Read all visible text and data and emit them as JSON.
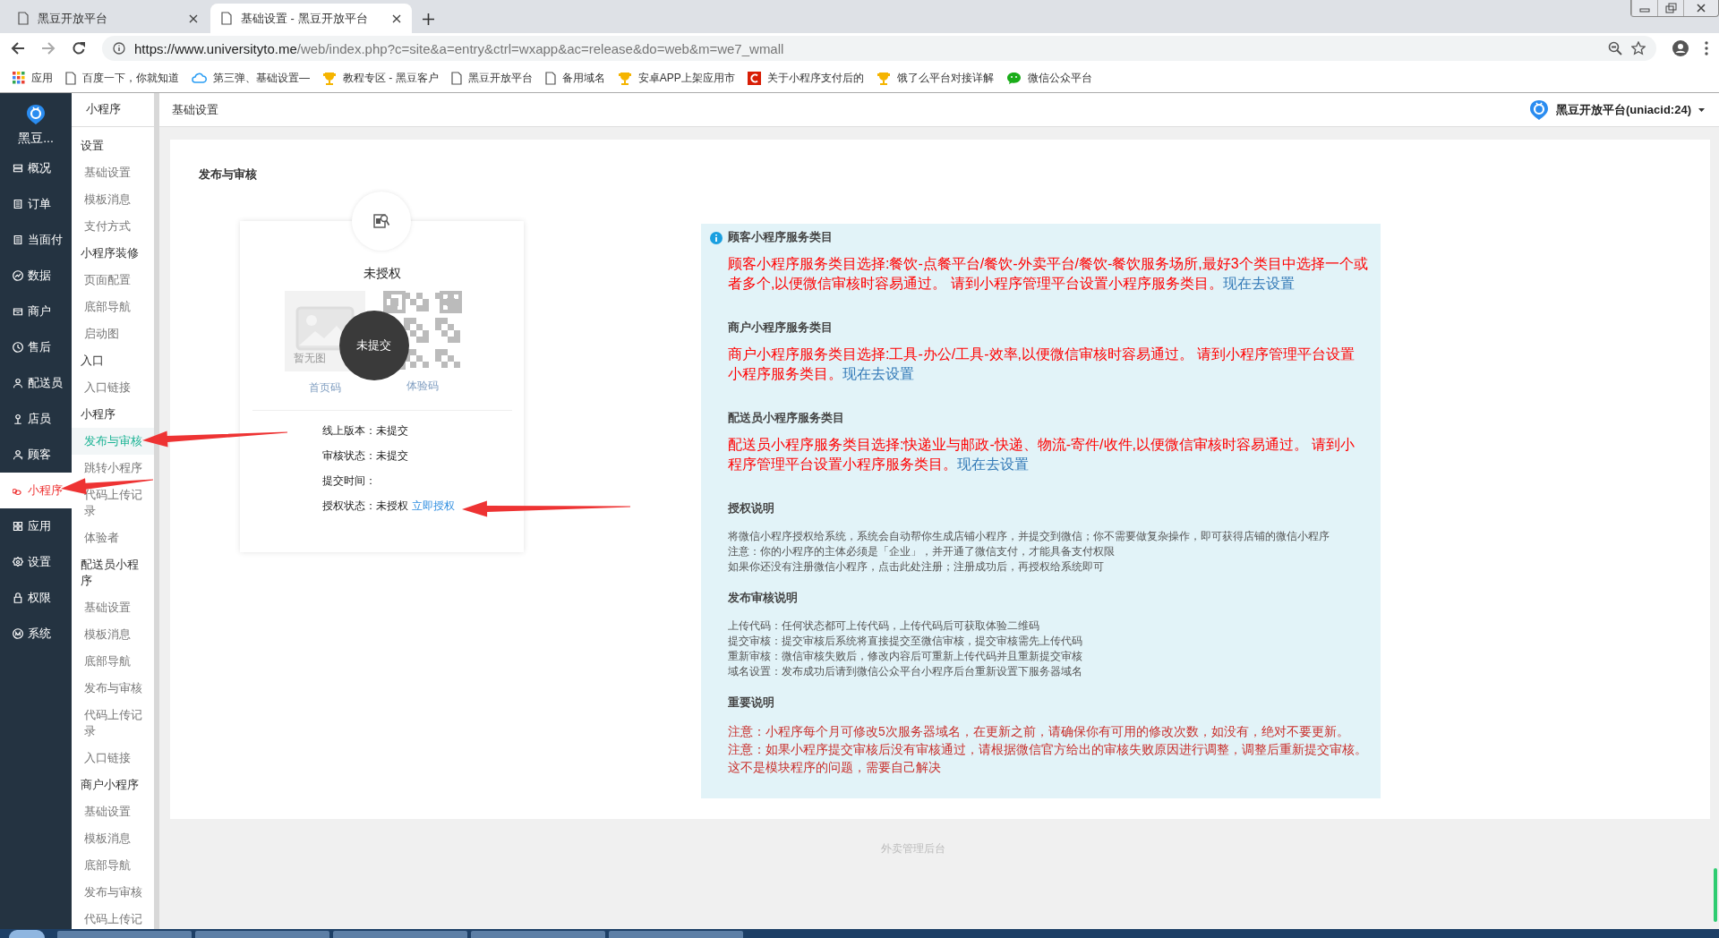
{
  "browser": {
    "tabs": [
      {
        "title": "黑豆开放平台",
        "selected": false
      },
      {
        "title": "基础设置 - 黑豆开放平台",
        "selected": true
      }
    ],
    "url": {
      "host": "https://www.universityto.me",
      "path": "/web/index.php?c=site&a=entry&ctrl=wxapp&ac=release&do=web&m=we7_wmall"
    },
    "bookmarks": [
      {
        "kind": "apps",
        "label": "应用"
      },
      {
        "kind": "page",
        "label": "百度一下，你就知道"
      },
      {
        "kind": "cloud",
        "label": "第三弹、基础设置—"
      },
      {
        "kind": "trophy",
        "label": "教程专区 - 黑豆客户"
      },
      {
        "kind": "page",
        "label": "黑豆开放平台"
      },
      {
        "kind": "page",
        "label": "备用域名"
      },
      {
        "kind": "trophy",
        "label": "安卓APP上架应用市"
      },
      {
        "kind": "red",
        "label": "关于小程序支付后的"
      },
      {
        "kind": "trophy",
        "label": "饿了么平台对接详解"
      },
      {
        "kind": "chat",
        "label": "微信公众平台"
      }
    ]
  },
  "app": {
    "brand": "黑豆...",
    "nav": [
      {
        "label": "概况",
        "selected": false
      },
      {
        "label": "订单",
        "selected": false
      },
      {
        "label": "当面付",
        "selected": false
      },
      {
        "label": "数据",
        "selected": false
      },
      {
        "label": "商户",
        "selected": false
      },
      {
        "label": "售后",
        "selected": false
      },
      {
        "label": "配送员",
        "selected": false
      },
      {
        "label": "店员",
        "selected": false
      },
      {
        "label": "顾客",
        "selected": false
      },
      {
        "label": "小程序",
        "selected": true
      },
      {
        "label": "应用",
        "selected": false
      },
      {
        "label": "设置",
        "selected": false
      },
      {
        "label": "权限",
        "selected": false
      },
      {
        "label": "系统",
        "selected": false
      }
    ],
    "subnav_title": "小程序",
    "subnav": [
      {
        "kind": "group",
        "label": "设置"
      },
      {
        "kind": "item",
        "label": "基础设置",
        "selected": false
      },
      {
        "kind": "item",
        "label": "模板消息",
        "selected": false
      },
      {
        "kind": "item",
        "label": "支付方式",
        "selected": false
      },
      {
        "kind": "group",
        "label": "小程序装修"
      },
      {
        "kind": "item",
        "label": "页面配置",
        "selected": false
      },
      {
        "kind": "item",
        "label": "底部导航",
        "selected": false
      },
      {
        "kind": "item",
        "label": "启动图",
        "selected": false
      },
      {
        "kind": "group",
        "label": "入口"
      },
      {
        "kind": "item",
        "label": "入口链接",
        "selected": false
      },
      {
        "kind": "group",
        "label": "小程序"
      },
      {
        "kind": "item",
        "label": "发布与审核",
        "selected": true
      },
      {
        "kind": "item",
        "label": "跳转小程序",
        "selected": false
      },
      {
        "kind": "item",
        "label": "代码上传记录",
        "selected": false
      },
      {
        "kind": "item",
        "label": "体验者",
        "selected": false
      },
      {
        "kind": "group",
        "label": "配送员小程序"
      },
      {
        "kind": "item",
        "label": "基础设置",
        "selected": false
      },
      {
        "kind": "item",
        "label": "模板消息",
        "selected": false
      },
      {
        "kind": "item",
        "label": "底部导航",
        "selected": false
      },
      {
        "kind": "item",
        "label": "发布与审核",
        "selected": false
      },
      {
        "kind": "item",
        "label": "代码上传记录",
        "selected": false
      },
      {
        "kind": "item",
        "label": "入口链接",
        "selected": false
      },
      {
        "kind": "group",
        "label": "商户小程序"
      },
      {
        "kind": "item",
        "label": "基础设置",
        "selected": false
      },
      {
        "kind": "item",
        "label": "模板消息",
        "selected": false
      },
      {
        "kind": "item",
        "label": "底部导航",
        "selected": false
      },
      {
        "kind": "item",
        "label": "发布与审核",
        "selected": false
      },
      {
        "kind": "item",
        "label": "代码上传记",
        "selected": false
      }
    ],
    "header": {
      "breadcrumb": "基础设置",
      "account": "黑豆开放平台(uniacid:24)"
    },
    "page": {
      "title": "发布与审核",
      "card": {
        "status": "未授权",
        "image_placeholder": "暂无图",
        "home_code": "首页码",
        "trial_code": "体验码",
        "overlay": "未提交",
        "fields": [
          {
            "label": "线上版本：",
            "value": "未提交"
          },
          {
            "label": "审核状态：",
            "value": "未提交"
          },
          {
            "label": "提交时间："
          },
          {
            "label": "授权状态：",
            "value": "未授权",
            "link": "立即授权"
          }
        ]
      },
      "info": [
        {
          "kind": "category",
          "title": "顾客小程序服务类目",
          "text": "顾客小程序服务类目选择:餐饮-点餐平台/餐饮-外卖平台/餐饮-餐饮服务场所,最好3个类目中选择一个或者多个,以便微信审核时容易通过。 请到小程序管理平台设置小程序服务类目。",
          "link": "现在去设置"
        },
        {
          "kind": "category",
          "title": "商户小程序服务类目",
          "text": "商户小程序服务类目选择:工具-办公/工具-效率,以便微信审核时容易通过。 请到小程序管理平台设置小程序服务类目。",
          "link": "现在去设置"
        },
        {
          "kind": "category",
          "title": "配送员小程序服务类目",
          "text": "配送员小程序服务类目选择:快递业与邮政-快递、物流-寄件/收件,以便微信审核时容易通过。 请到小程序管理平台设置小程序服务类目。",
          "link": "现在去设置"
        },
        {
          "kind": "notes",
          "title": "授权说明",
          "lines": [
            "将微信小程序授权给系统，系统会自动帮你生成店铺小程序，并提交到微信；你不需要做复杂操作，即可获得店铺的微信小程序",
            "注意：你的小程序的主体必须是「企业」，并开通了微信支付，才能具备支付权限",
            "如果你还没有注册微信小程序，点击此处注册；注册成功后，再授权给系统即可"
          ]
        },
        {
          "kind": "notes",
          "title": "发布审核说明",
          "lines": [
            "上传代码：任何状态都可上传代码，上传代码后可获取体验二维码",
            "提交审核：提交审核后系统将直接提交至微信审核，提交审核需先上传代码",
            "重新审核：微信审核失败后，修改内容后可重新上传代码并且重新提交审核",
            "域名设置：发布成功后请到微信公众平台小程序后台重新设置下服务器域名"
          ]
        },
        {
          "kind": "important",
          "title": "重要说明",
          "lines": [
            "注意：小程序每个月可修改5次服务器域名，在更新之前，请确保你有可用的修改次数，如没有，绝对不要更新。",
            "注意：如果小程序提交审核后没有审核通过，请根据微信官方给出的审核失败原因进行调整，调整后重新提交审核。这不是模块程序的问题，需要自己解决"
          ]
        }
      ]
    },
    "footer": "外卖管理后台"
  }
}
